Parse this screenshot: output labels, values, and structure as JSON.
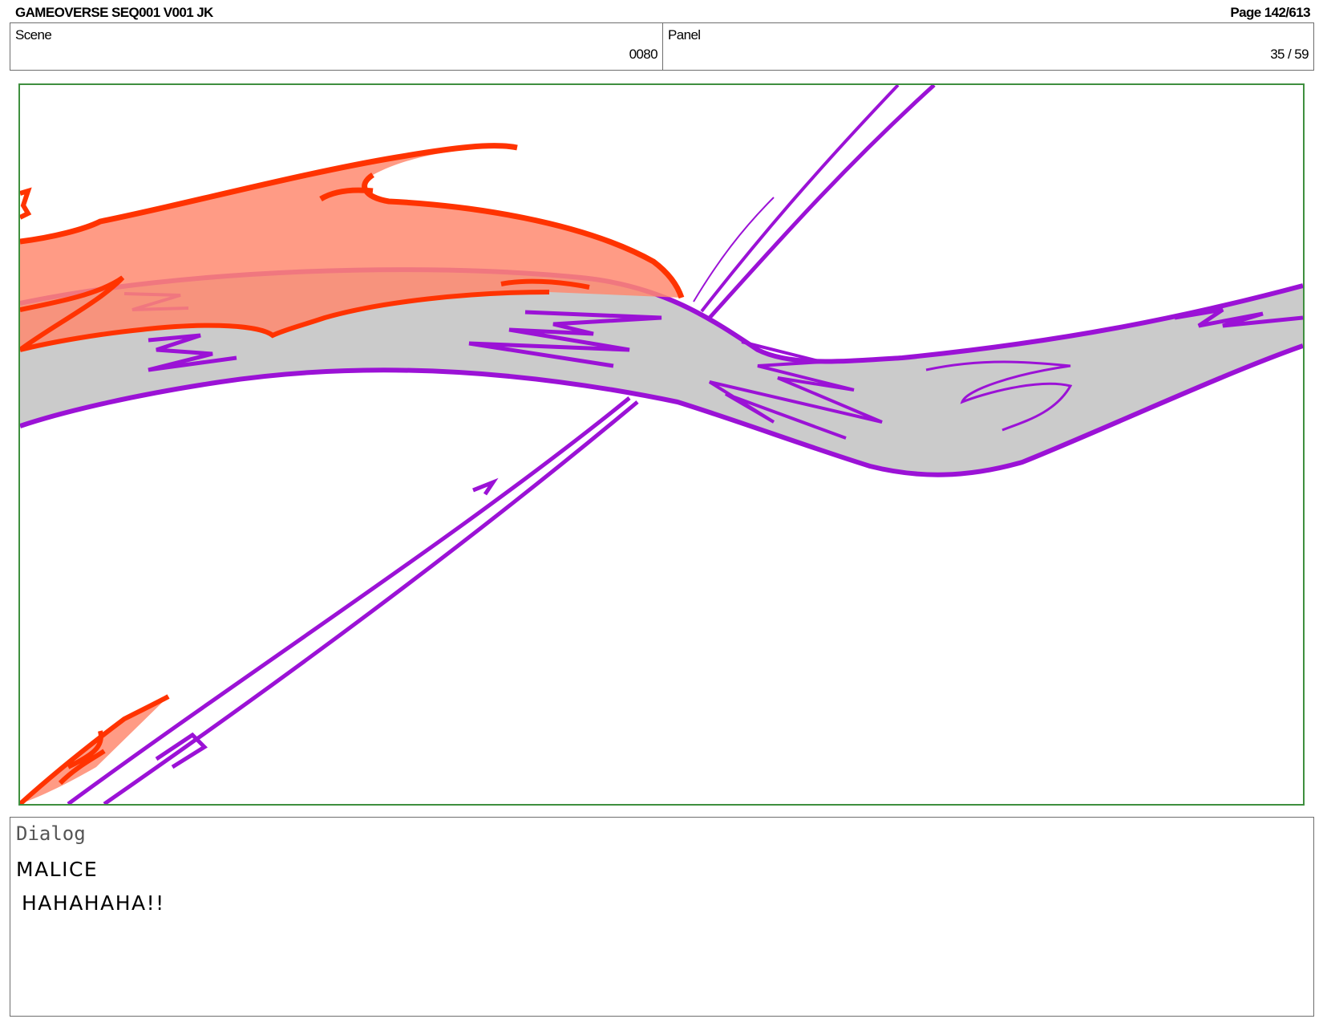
{
  "header": {
    "title": "GAMEOVERSE SEQ001 V001 JK",
    "page": "Page 142/613"
  },
  "scene": {
    "label": "Scene",
    "value": "0080"
  },
  "panel": {
    "label": "Panel",
    "value": "35 / 59"
  },
  "artwork": {
    "colors": {
      "frame": "#3f8f3f",
      "purple": "#9b12d6",
      "gray_fill": "#cbcbcb",
      "red": "#ff3300",
      "red_fill": "#ff8a70"
    }
  },
  "dialog": {
    "label": "Dialog",
    "character": "MALICE",
    "line": "HAHAHAHA!!"
  }
}
